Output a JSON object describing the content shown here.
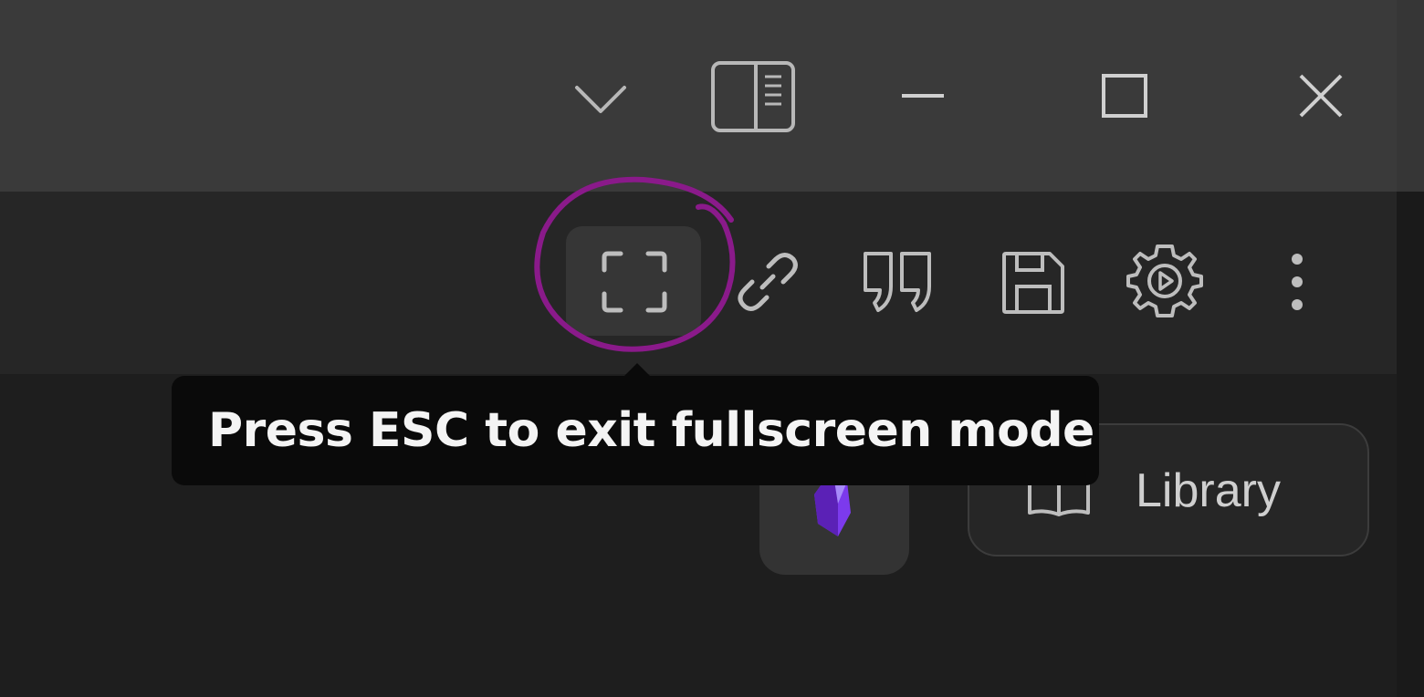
{
  "titlebar": {
    "icons": [
      "chevron-down-icon",
      "sidebar-layout-icon",
      "minimize-icon",
      "maximize-icon",
      "close-icon"
    ]
  },
  "toolbar": {
    "icons": [
      "fullscreen-icon",
      "link-icon",
      "quote-icon",
      "save-icon",
      "settings-play-icon",
      "more-vertical-icon"
    ]
  },
  "tooltip": {
    "text": "Press ESC to exit fullscreen mode"
  },
  "content": {
    "library_label": "Library",
    "vault_icon": "obsidian-crystal-icon"
  },
  "colors": {
    "annotation": "#8a1a8a",
    "crystal": "#7c3aed",
    "titlebar": "#3a3a3a",
    "toolbar": "#262626",
    "tooltip": "#0a0a0a"
  }
}
